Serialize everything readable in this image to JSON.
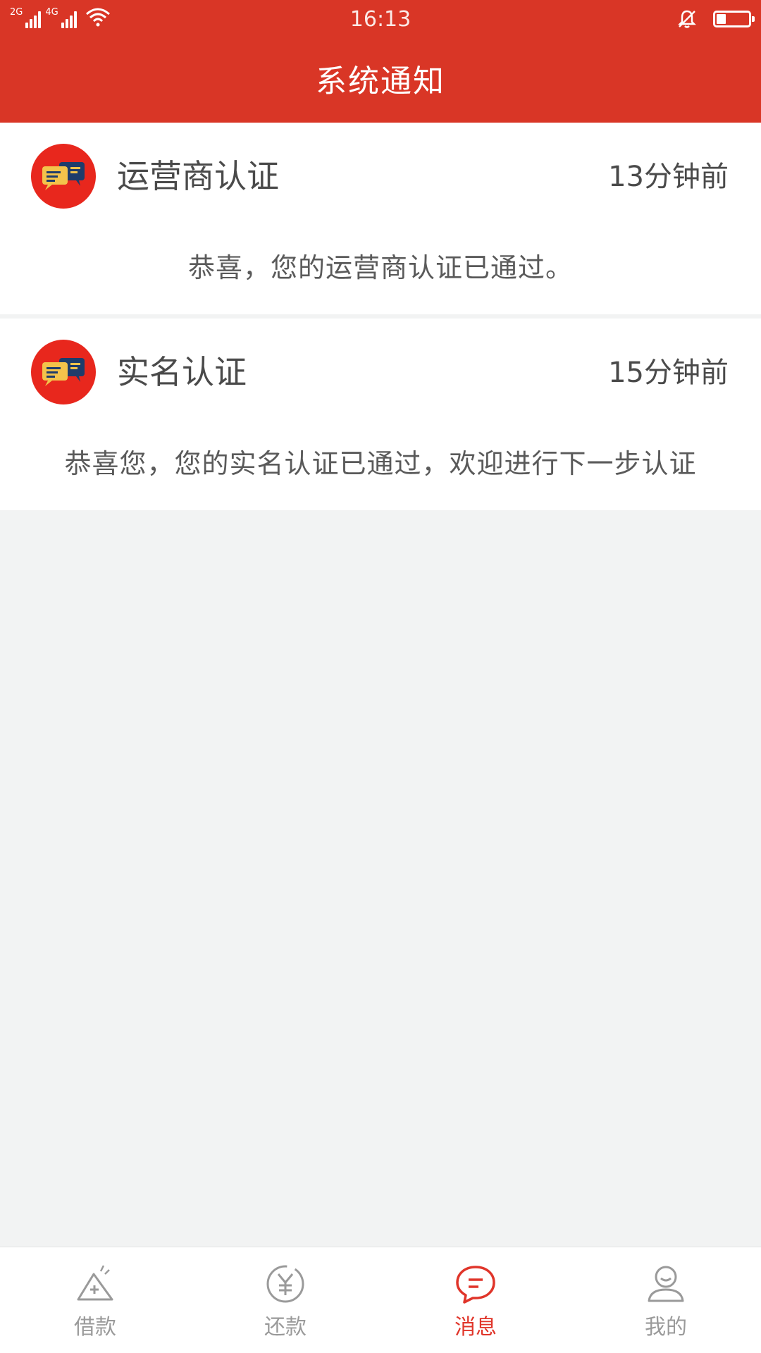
{
  "status_bar": {
    "time": "16:13",
    "network_1": "2G",
    "network_2": "4G",
    "battery_level": 0.3
  },
  "header": {
    "title": "系统通知"
  },
  "notifications": [
    {
      "title": "运营商认证",
      "time": "13分钟前",
      "message": "恭喜，您的运营商认证已通过。"
    },
    {
      "title": "实名认证",
      "time": "15分钟前",
      "message": "恭喜您，您的实名认证已通过，欢迎进行下一步认证"
    }
  ],
  "tabbar": {
    "items": [
      {
        "label": "借款",
        "icon": "loan-icon",
        "active": false
      },
      {
        "label": "还款",
        "icon": "repay-icon",
        "active": false
      },
      {
        "label": "消息",
        "icon": "message-icon",
        "active": true
      },
      {
        "label": "我的",
        "icon": "profile-icon",
        "active": false
      }
    ]
  },
  "colors": {
    "brand": "#d93626",
    "active_tab": "#e0352a",
    "inactive_tab": "#9a9a9a",
    "background": "#f2f3f3"
  }
}
